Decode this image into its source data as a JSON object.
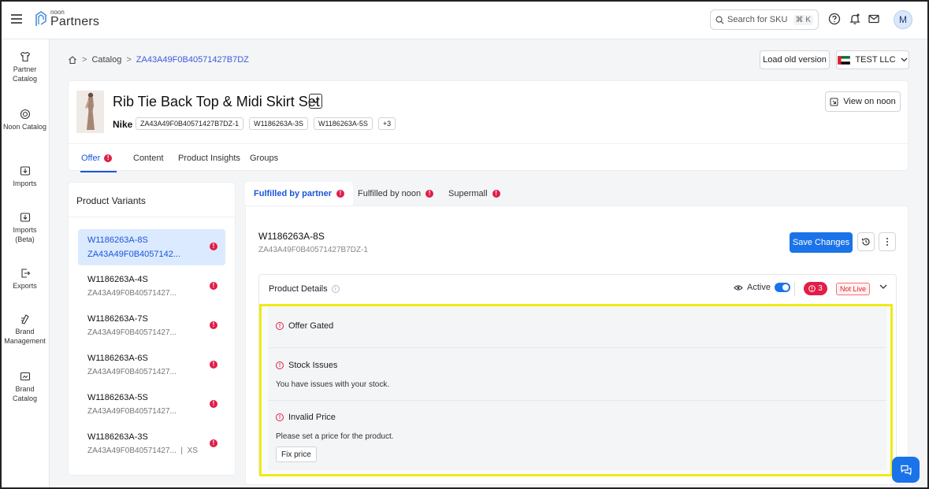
{
  "header": {
    "logo_small": "noon",
    "logo_big": "Partners",
    "search_placeholder": "Search for SKU ...",
    "search_shortcut": "⌘ K",
    "avatar_initial": "M"
  },
  "sidebar": {
    "items": [
      {
        "label": "Partner Catalog"
      },
      {
        "label": "Noon Catalog"
      },
      {
        "label": "Imports"
      },
      {
        "label": "Imports (Beta)"
      },
      {
        "label": "Exports"
      },
      {
        "label": "Brand Management"
      },
      {
        "label": "Brand Catalog"
      }
    ]
  },
  "breadcrumb": {
    "catalog": "Catalog",
    "sep": ">",
    "current": "ZA43A49F0B40571427B7DZ"
  },
  "toolbar": {
    "load_old_version": "Load old version",
    "store_name": "TEST LLC"
  },
  "product": {
    "title": "Rib Tie Back Top & Midi Skirt Set",
    "brand": "Nike",
    "chips": [
      "ZA43A49F0B40571427B7DZ-1",
      "W1186263A-3S",
      "W1186263A-5S",
      "+3"
    ],
    "view_on_noon": "View on noon",
    "tabs": [
      {
        "label": "Offer"
      },
      {
        "label": "Content"
      },
      {
        "label": "Product Insights"
      },
      {
        "label": "Groups"
      }
    ]
  },
  "variants": {
    "title": "Product Variants",
    "items": [
      {
        "sku": "W1186263A-8S",
        "id": "ZA43A49F0B4057142..."
      },
      {
        "sku": "W1186263A-4S",
        "id": "ZA43A49F0B40571427..."
      },
      {
        "sku": "W1186263A-7S",
        "id": "ZA43A49F0B40571427..."
      },
      {
        "sku": "W1186263A-6S",
        "id": "ZA43A49F0B40571427..."
      },
      {
        "sku": "W1186263A-5S",
        "id": "ZA43A49F0B40571427..."
      },
      {
        "sku": "W1186263A-3S",
        "id": "ZA43A49F0B40571427...",
        "size": "XS"
      }
    ]
  },
  "channels": {
    "tabs": [
      {
        "label": "Fulfilled by partner"
      },
      {
        "label": "Fulfilled by noon"
      },
      {
        "label": "Supermall"
      }
    ]
  },
  "offer": {
    "sku": "W1186263A-8S",
    "id": "ZA43A49F0B40571427B7DZ-1",
    "save_label": "Save Changes",
    "details_title": "Product Details",
    "active_label": "Active",
    "error_count": "3",
    "status_badge": "Not Live",
    "issues": [
      {
        "title": "Offer Gated"
      },
      {
        "title": "Stock Issues",
        "desc": "You have issues with your stock."
      },
      {
        "title": "Invalid Price",
        "desc": "Please set a price for the product.",
        "action": "Fix price"
      }
    ]
  },
  "colors": {
    "primary": "#1a73e8",
    "error": "#e11d48",
    "highlight": "#f0ea14"
  },
  "icons": {
    "error_glyph": "!",
    "info_glyph": "i"
  }
}
